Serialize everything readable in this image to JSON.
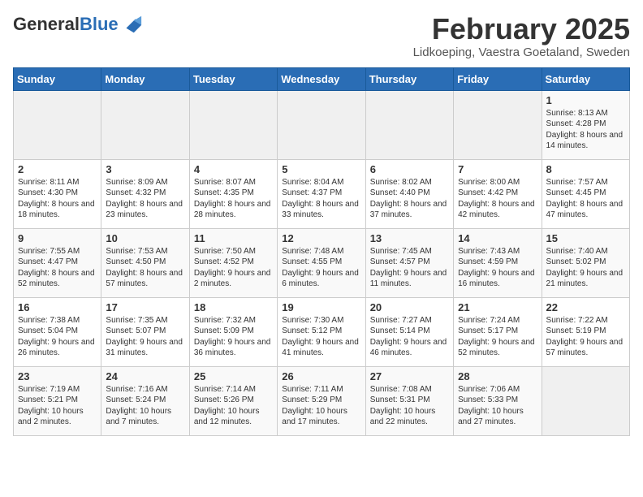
{
  "logo": {
    "general": "General",
    "blue": "Blue"
  },
  "title": "February 2025",
  "location": "Lidkoeping, Vaestra Goetaland, Sweden",
  "weekdays": [
    "Sunday",
    "Monday",
    "Tuesday",
    "Wednesday",
    "Thursday",
    "Friday",
    "Saturday"
  ],
  "weeks": [
    [
      {
        "day": "",
        "info": ""
      },
      {
        "day": "",
        "info": ""
      },
      {
        "day": "",
        "info": ""
      },
      {
        "day": "",
        "info": ""
      },
      {
        "day": "",
        "info": ""
      },
      {
        "day": "",
        "info": ""
      },
      {
        "day": "1",
        "info": "Sunrise: 8:13 AM\nSunset: 4:28 PM\nDaylight: 8 hours and 14 minutes."
      }
    ],
    [
      {
        "day": "2",
        "info": "Sunrise: 8:11 AM\nSunset: 4:30 PM\nDaylight: 8 hours and 18 minutes."
      },
      {
        "day": "3",
        "info": "Sunrise: 8:09 AM\nSunset: 4:32 PM\nDaylight: 8 hours and 23 minutes."
      },
      {
        "day": "4",
        "info": "Sunrise: 8:07 AM\nSunset: 4:35 PM\nDaylight: 8 hours and 28 minutes."
      },
      {
        "day": "5",
        "info": "Sunrise: 8:04 AM\nSunset: 4:37 PM\nDaylight: 8 hours and 33 minutes."
      },
      {
        "day": "6",
        "info": "Sunrise: 8:02 AM\nSunset: 4:40 PM\nDaylight: 8 hours and 37 minutes."
      },
      {
        "day": "7",
        "info": "Sunrise: 8:00 AM\nSunset: 4:42 PM\nDaylight: 8 hours and 42 minutes."
      },
      {
        "day": "8",
        "info": "Sunrise: 7:57 AM\nSunset: 4:45 PM\nDaylight: 8 hours and 47 minutes."
      }
    ],
    [
      {
        "day": "9",
        "info": "Sunrise: 7:55 AM\nSunset: 4:47 PM\nDaylight: 8 hours and 52 minutes."
      },
      {
        "day": "10",
        "info": "Sunrise: 7:53 AM\nSunset: 4:50 PM\nDaylight: 8 hours and 57 minutes."
      },
      {
        "day": "11",
        "info": "Sunrise: 7:50 AM\nSunset: 4:52 PM\nDaylight: 9 hours and 2 minutes."
      },
      {
        "day": "12",
        "info": "Sunrise: 7:48 AM\nSunset: 4:55 PM\nDaylight: 9 hours and 6 minutes."
      },
      {
        "day": "13",
        "info": "Sunrise: 7:45 AM\nSunset: 4:57 PM\nDaylight: 9 hours and 11 minutes."
      },
      {
        "day": "14",
        "info": "Sunrise: 7:43 AM\nSunset: 4:59 PM\nDaylight: 9 hours and 16 minutes."
      },
      {
        "day": "15",
        "info": "Sunrise: 7:40 AM\nSunset: 5:02 PM\nDaylight: 9 hours and 21 minutes."
      }
    ],
    [
      {
        "day": "16",
        "info": "Sunrise: 7:38 AM\nSunset: 5:04 PM\nDaylight: 9 hours and 26 minutes."
      },
      {
        "day": "17",
        "info": "Sunrise: 7:35 AM\nSunset: 5:07 PM\nDaylight: 9 hours and 31 minutes."
      },
      {
        "day": "18",
        "info": "Sunrise: 7:32 AM\nSunset: 5:09 PM\nDaylight: 9 hours and 36 minutes."
      },
      {
        "day": "19",
        "info": "Sunrise: 7:30 AM\nSunset: 5:12 PM\nDaylight: 9 hours and 41 minutes."
      },
      {
        "day": "20",
        "info": "Sunrise: 7:27 AM\nSunset: 5:14 PM\nDaylight: 9 hours and 46 minutes."
      },
      {
        "day": "21",
        "info": "Sunrise: 7:24 AM\nSunset: 5:17 PM\nDaylight: 9 hours and 52 minutes."
      },
      {
        "day": "22",
        "info": "Sunrise: 7:22 AM\nSunset: 5:19 PM\nDaylight: 9 hours and 57 minutes."
      }
    ],
    [
      {
        "day": "23",
        "info": "Sunrise: 7:19 AM\nSunset: 5:21 PM\nDaylight: 10 hours and 2 minutes."
      },
      {
        "day": "24",
        "info": "Sunrise: 7:16 AM\nSunset: 5:24 PM\nDaylight: 10 hours and 7 minutes."
      },
      {
        "day": "25",
        "info": "Sunrise: 7:14 AM\nSunset: 5:26 PM\nDaylight: 10 hours and 12 minutes."
      },
      {
        "day": "26",
        "info": "Sunrise: 7:11 AM\nSunset: 5:29 PM\nDaylight: 10 hours and 17 minutes."
      },
      {
        "day": "27",
        "info": "Sunrise: 7:08 AM\nSunset: 5:31 PM\nDaylight: 10 hours and 22 minutes."
      },
      {
        "day": "28",
        "info": "Sunrise: 7:06 AM\nSunset: 5:33 PM\nDaylight: 10 hours and 27 minutes."
      },
      {
        "day": "",
        "info": ""
      }
    ]
  ]
}
